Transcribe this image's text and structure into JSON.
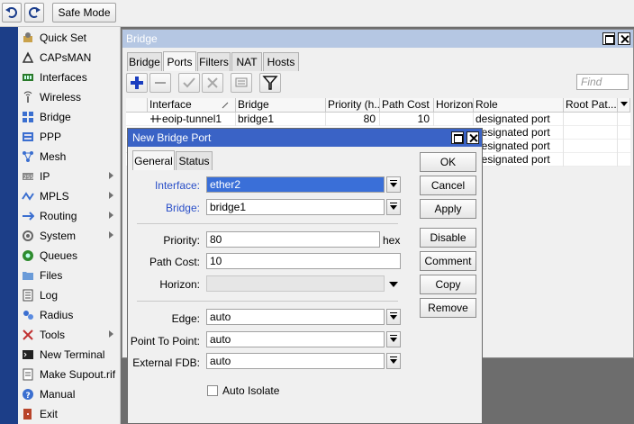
{
  "toolbar": {
    "safe_mode_label": "Safe Mode",
    "undo_icon": "undo-icon",
    "redo_icon": "redo-icon"
  },
  "sidebar": {
    "items": [
      {
        "label": "Quick Set",
        "icon": "quick-set-icon",
        "submenu": false
      },
      {
        "label": "CAPsMAN",
        "icon": "capsman-icon",
        "submenu": false
      },
      {
        "label": "Interfaces",
        "icon": "interfaces-icon",
        "submenu": false
      },
      {
        "label": "Wireless",
        "icon": "wireless-icon",
        "submenu": false
      },
      {
        "label": "Bridge",
        "icon": "bridge-icon",
        "submenu": false
      },
      {
        "label": "PPP",
        "icon": "ppp-icon",
        "submenu": false
      },
      {
        "label": "Mesh",
        "icon": "mesh-icon",
        "submenu": false
      },
      {
        "label": "IP",
        "icon": "ip-icon",
        "submenu": true
      },
      {
        "label": "MPLS",
        "icon": "mpls-icon",
        "submenu": true
      },
      {
        "label": "Routing",
        "icon": "routing-icon",
        "submenu": true
      },
      {
        "label": "System",
        "icon": "system-icon",
        "submenu": true
      },
      {
        "label": "Queues",
        "icon": "queues-icon",
        "submenu": false
      },
      {
        "label": "Files",
        "icon": "files-icon",
        "submenu": false
      },
      {
        "label": "Log",
        "icon": "log-icon",
        "submenu": false
      },
      {
        "label": "Radius",
        "icon": "radius-icon",
        "submenu": false
      },
      {
        "label": "Tools",
        "icon": "tools-icon",
        "submenu": true
      },
      {
        "label": "New Terminal",
        "icon": "terminal-icon",
        "submenu": false
      },
      {
        "label": "Make Supout.rif",
        "icon": "supout-icon",
        "submenu": false
      },
      {
        "label": "Manual",
        "icon": "manual-icon",
        "submenu": false
      },
      {
        "label": "Exit",
        "icon": "exit-icon",
        "submenu": false
      }
    ]
  },
  "bridge_window": {
    "title": "Bridge",
    "tabs": [
      "Bridge",
      "Ports",
      "Filters",
      "NAT",
      "Hosts"
    ],
    "active_tab": "Ports",
    "find_placeholder": "Find",
    "columns": [
      "Interface",
      "Bridge",
      "Priority (h...",
      "Path Cost",
      "Horizon",
      "Role",
      "Root Pat..."
    ],
    "rows": [
      {
        "interface": "eoip-tunnel1",
        "bridge": "bridge1",
        "priority": "80",
        "path_cost": "10",
        "horizon": "",
        "role": "designated port",
        "root_path": ""
      },
      {
        "interface": "",
        "bridge": "",
        "priority": "",
        "path_cost": "",
        "horizon": "",
        "role": "designated port",
        "root_path": ""
      },
      {
        "interface": "",
        "bridge": "",
        "priority": "",
        "path_cost": "",
        "horizon": "",
        "role": "designated port",
        "root_path": ""
      },
      {
        "interface": "",
        "bridge": "",
        "priority": "",
        "path_cost": "",
        "horizon": "",
        "role": "designated port",
        "root_path": ""
      }
    ]
  },
  "dialog": {
    "title": "New Bridge Port",
    "tabs": [
      "General",
      "Status"
    ],
    "active_tab": "General",
    "fields": {
      "interface": {
        "label": "Interface:",
        "value": "ether2"
      },
      "bridge": {
        "label": "Bridge:",
        "value": "bridge1"
      },
      "priority": {
        "label": "Priority:",
        "value": "80",
        "suffix": "hex"
      },
      "path_cost": {
        "label": "Path Cost:",
        "value": "10"
      },
      "horizon": {
        "label": "Horizon:",
        "value": ""
      },
      "edge": {
        "label": "Edge:",
        "value": "auto"
      },
      "point_to_point": {
        "label": "Point To Point:",
        "value": "auto"
      },
      "external_fdb": {
        "label": "External FDB:",
        "value": "auto"
      },
      "auto_isolate": {
        "label": "Auto Isolate",
        "checked": false
      }
    },
    "buttons": [
      "OK",
      "Cancel",
      "Apply",
      "Disable",
      "Comment",
      "Copy",
      "Remove"
    ]
  },
  "colors": {
    "title_active": "#3a63c6",
    "title_inactive": "#b5c7e3",
    "label_blue": "#2a4fc8",
    "sidebar_strip": "#1c3e88",
    "selection": "#3a6fd8"
  }
}
